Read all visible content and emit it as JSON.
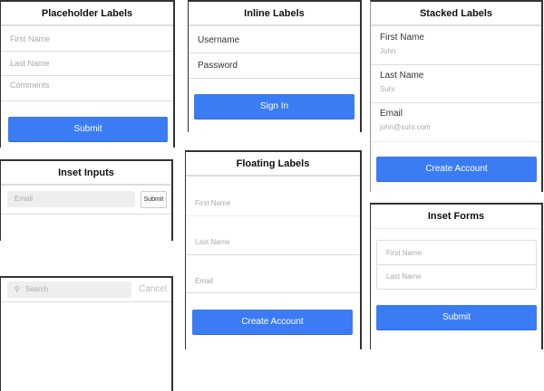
{
  "placeholder_labels": {
    "title": "Placeholder Labels",
    "first_name": "First Name",
    "last_name": "Last Name",
    "comments": "Comments",
    "submit": "Submit"
  },
  "inset_inputs": {
    "title": "Inset Inputs",
    "email": "Email",
    "submit": "Submit"
  },
  "search": {
    "placeholder": "Search",
    "cancel": "Cancel",
    "icon": "search-icon"
  },
  "inline_labels": {
    "title": "Inline Labels",
    "username": "Username",
    "password": "Password",
    "sign_in": "Sign In"
  },
  "floating_labels": {
    "title": "Floating Labels",
    "first_name": "First Name",
    "last_name": "Last Name",
    "email": "Email",
    "create": "Create Account"
  },
  "stacked_labels": {
    "title": "Stacked Labels",
    "fields": [
      {
        "label": "First Name",
        "value": "John"
      },
      {
        "label": "Last Name",
        "value": "Suhr"
      },
      {
        "label": "Email",
        "value": "john@suhr.com"
      }
    ],
    "create": "Create Account"
  },
  "inset_forms": {
    "title": "Inset Forms",
    "first_name": "First Name",
    "last_name": "Last Name",
    "submit": "Submit"
  },
  "colors": {
    "accent": "#3b7cf5"
  }
}
